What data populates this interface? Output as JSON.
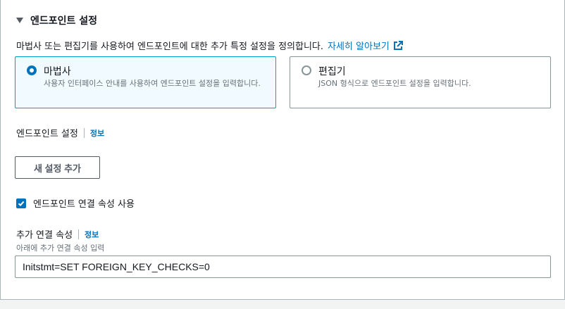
{
  "section": {
    "title": "엔드포인트 설정",
    "description": "마법사 또는 편집기를 사용하여 엔드포인트에 대한 추가 특정 설정을 정의합니다.",
    "learn_more": "자세히 알아보기"
  },
  "mode_options": [
    {
      "title": "마법사",
      "description": "사용자 인터페이스 안내를 사용하여 엔드포인트 설정을 입력합니다.",
      "selected": true
    },
    {
      "title": "편집기",
      "description": "JSON 형식으로 엔드포인트 설정을 입력합니다.",
      "selected": false
    }
  ],
  "endpoint_settings": {
    "label": "엔드포인트 설정",
    "info": "정보",
    "add_button": "새 설정 추가"
  },
  "connection_attributes_checkbox": {
    "label": "엔드포인트 연결 속성 사용",
    "checked": true
  },
  "extra_connection_attributes": {
    "label": "추가 연결 속성",
    "info": "정보",
    "hint": "아래에 추가 연결 속성 입력",
    "value": "Initstmt=SET FOREIGN_KEY_CHECKS=0"
  },
  "colors": {
    "accent": "#0073bb",
    "selected_tile_border": "#00a1c9",
    "selected_tile_bg": "#f1faff"
  }
}
